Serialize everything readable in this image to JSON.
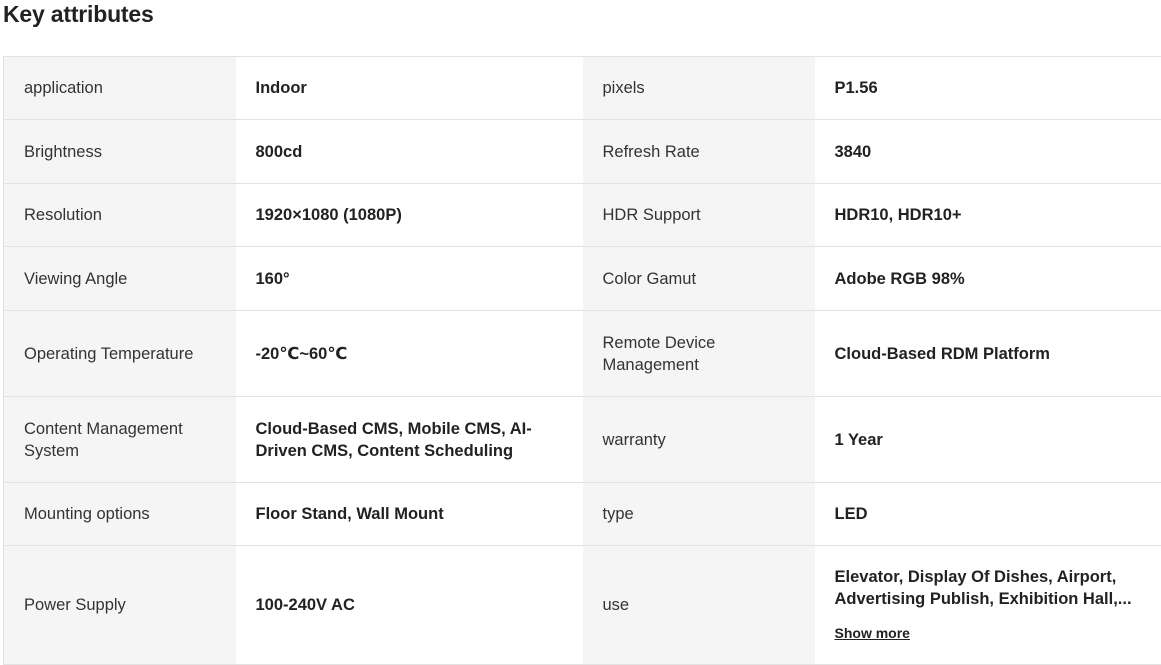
{
  "title": "Key attributes",
  "rows": [
    {
      "k1": "application",
      "v1": "Indoor",
      "k2": "pixels",
      "v2": "P1.56"
    },
    {
      "k1": "Brightness",
      "v1": "800cd",
      "k2": "Refresh Rate",
      "v2": "3840"
    },
    {
      "k1": "Resolution",
      "v1": "1920×1080 (1080P)",
      "k2": "HDR Support",
      "v2": "HDR10, HDR10+"
    },
    {
      "k1": "Viewing Angle",
      "v1": "160°",
      "k2": "Color Gamut",
      "v2": "Adobe RGB 98%"
    },
    {
      "k1": "Operating Temperature",
      "v1": "-20℃~60℃",
      "k2": "Remote Device Management",
      "v2": "Cloud-Based RDM Platform"
    },
    {
      "k1": "Content Management System",
      "v1": "Cloud-Based CMS, Mobile CMS, AI-Driven CMS, Content Scheduling",
      "k2": "warranty",
      "v2": "1 Year"
    },
    {
      "k1": "Mounting options",
      "v1": "Floor Stand, Wall Mount",
      "k2": "type",
      "v2": "LED"
    },
    {
      "k1": "Power Supply",
      "v1": "100-240V AC",
      "k2": "use",
      "v2": "Elevator, Display Of Dishes, Airport, Advertising Publish, Exhibition Hall,..."
    }
  ],
  "show_more_label": "Show more"
}
